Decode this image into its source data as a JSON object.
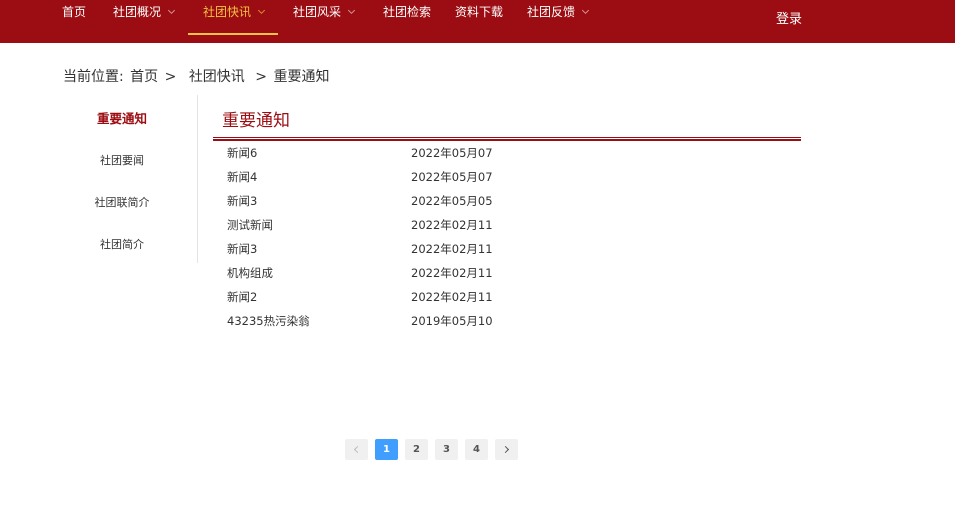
{
  "nav": {
    "items": [
      {
        "label": "首页",
        "has_dropdown": false
      },
      {
        "label": "社团概况",
        "has_dropdown": true
      },
      {
        "label": "社团快讯",
        "has_dropdown": true,
        "active": true
      },
      {
        "label": "社团风采",
        "has_dropdown": true
      },
      {
        "label": "社团检索",
        "has_dropdown": false
      },
      {
        "label": "资料下载",
        "has_dropdown": false
      },
      {
        "label": "社团反馈",
        "has_dropdown": true
      }
    ],
    "login_label": "登录"
  },
  "breadcrumb": {
    "prefix": "当前位置:",
    "home": "首页",
    "sep1": ">",
    "section": "社团快讯",
    "sep2": ">",
    "current": "重要通知"
  },
  "sidebar": {
    "items": [
      {
        "label": "重要通知",
        "active": true
      },
      {
        "label": "社团要闻"
      },
      {
        "label": "社团联简介"
      },
      {
        "label": "社团简介"
      }
    ]
  },
  "main": {
    "title": "重要通知",
    "news": [
      {
        "title": "新闻6",
        "date": "2022年05月07"
      },
      {
        "title": "新闻4",
        "date": "2022年05月07"
      },
      {
        "title": "新闻3",
        "date": "2022年05月05"
      },
      {
        "title": "测试新闻",
        "date": "2022年02月11"
      },
      {
        "title": "新闻3",
        "date": "2022年02月11"
      },
      {
        "title": "机构组成",
        "date": "2022年02月11"
      },
      {
        "title": "新闻2",
        "date": "2022年02月11"
      },
      {
        "title": "43235热污染翁",
        "date": "2019年05月10"
      }
    ]
  },
  "pagination": {
    "pages": [
      "1",
      "2",
      "3",
      "4"
    ],
    "current": "1",
    "prev_icon": "chevron-left-icon",
    "next_icon": "chevron-right-icon"
  },
  "colors": {
    "brand": "#9b0d12",
    "nav_active": "#f5c242",
    "page_active": "#409eff"
  }
}
